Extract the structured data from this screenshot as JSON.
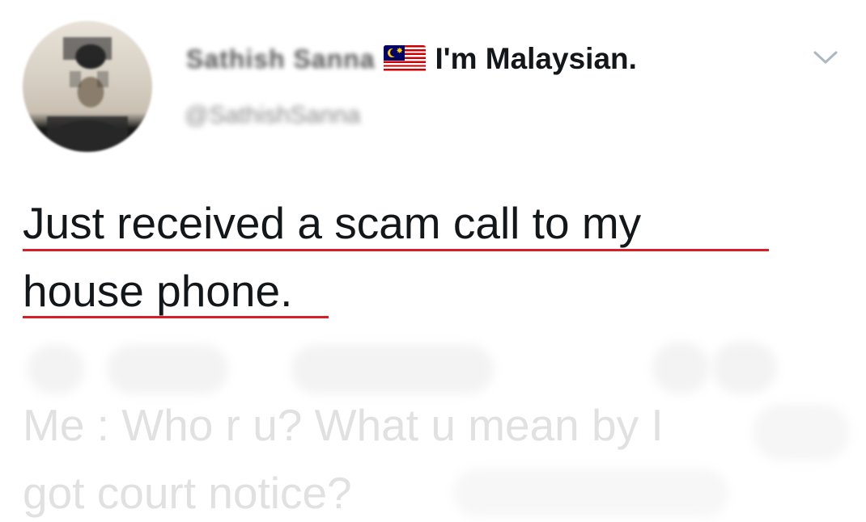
{
  "author": {
    "display_name_blurred": "Sathish Sanna",
    "display_name_suffix": "I'm Malaysian.",
    "flag_icon": "malaysia-flag-icon",
    "handle_blurred": "@SathishSanna"
  },
  "menu": {
    "chevron_icon": "chevron-down-icon"
  },
  "tweet": {
    "line1": "Just received a scam call to my",
    "line2": "house phone.",
    "faded_line1": "Me : Who r u? What u mean by I",
    "faded_line2": "got court notice?"
  },
  "colors": {
    "text": "#14171a",
    "underline": "#d61f26",
    "faded_text": "#e1e1e1",
    "chevron": "#aab8c2"
  }
}
